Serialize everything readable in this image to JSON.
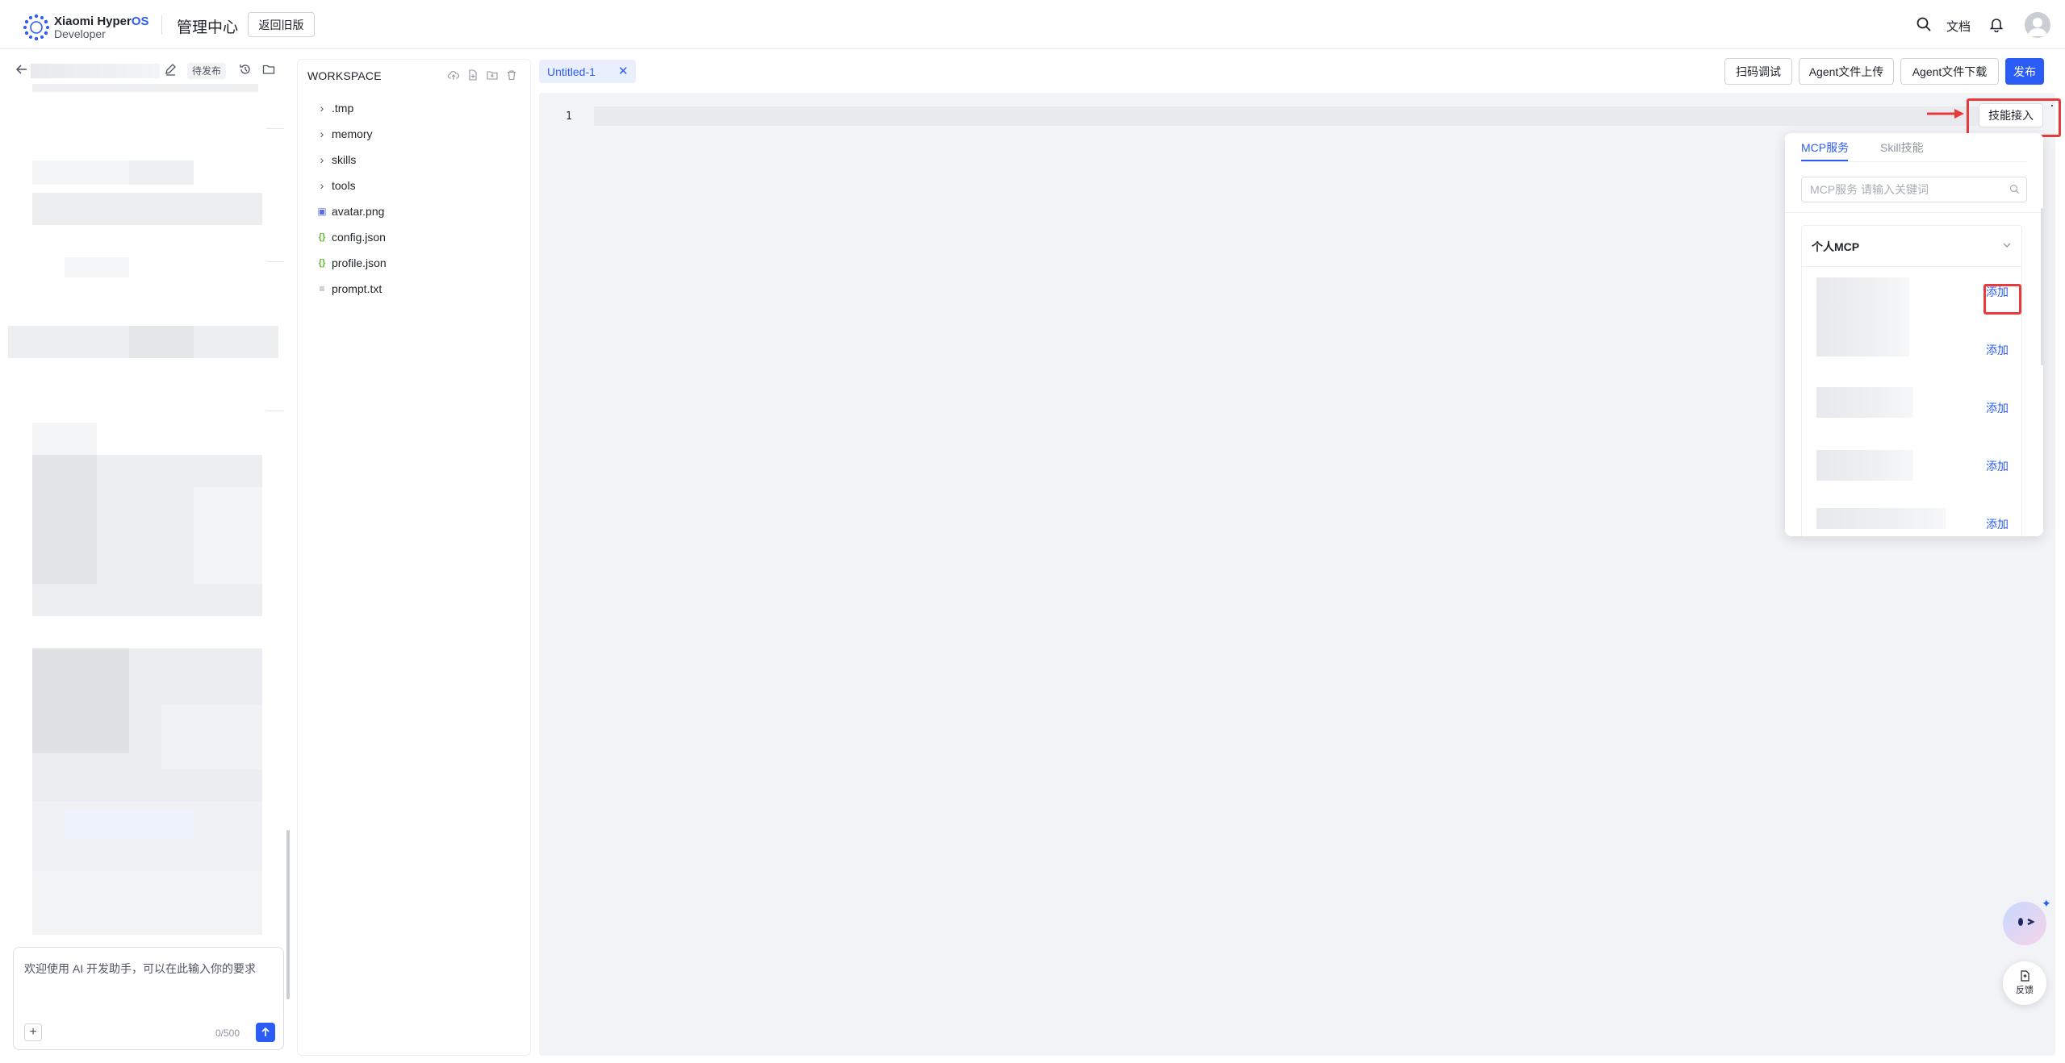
{
  "header": {
    "brand_name": "Xiaomi Hyper",
    "brand_os": "OS",
    "brand_sub": "Developer",
    "app_title": "管理中心",
    "back_old_label": "返回旧版",
    "docs_label": "文档",
    "icons": [
      "search-icon",
      "bell-icon",
      "user-avatar"
    ]
  },
  "chat": {
    "status_badge": "待发布",
    "input_placeholder": "欢迎使用 AI 开发助手，可以在此输入你的要求",
    "char_count": "0/500",
    "icons": [
      "back-arrow-icon",
      "edit-icon",
      "history-icon",
      "folder-icon",
      "plus-icon",
      "send-icon"
    ]
  },
  "workspace": {
    "title": "WORKSPACE",
    "toolbar_icons": [
      "upload-cloud-icon",
      "new-file-icon",
      "new-folder-icon",
      "delete-icon"
    ],
    "items": [
      {
        "name": ".tmp",
        "type": "folder"
      },
      {
        "name": "memory",
        "type": "folder"
      },
      {
        "name": "skills",
        "type": "folder"
      },
      {
        "name": "tools",
        "type": "folder"
      },
      {
        "name": "avatar.png",
        "type": "image"
      },
      {
        "name": "config.json",
        "type": "json"
      },
      {
        "name": "profile.json",
        "type": "json"
      },
      {
        "name": "prompt.txt",
        "type": "text"
      }
    ]
  },
  "editor": {
    "tab_label": "Untitled-1",
    "line_number": "1"
  },
  "actions": {
    "scan_debug": "扫码调试",
    "agent_upload": "Agent文件上传",
    "agent_download": "Agent文件下载",
    "publish": "发布",
    "skill_access": "技能接入"
  },
  "dropdown": {
    "tab_mcp": "MCP服务",
    "tab_skill": "Skill技能",
    "search_placeholder": "MCP服务 请输入关键词",
    "group_title": "个人MCP",
    "add_label": "添加"
  },
  "feedback": {
    "label": "反馈"
  },
  "colors": {
    "accent": "#2c5cf6",
    "highlight": "#e83a3a",
    "editor_bg": "#f2f3f7"
  }
}
